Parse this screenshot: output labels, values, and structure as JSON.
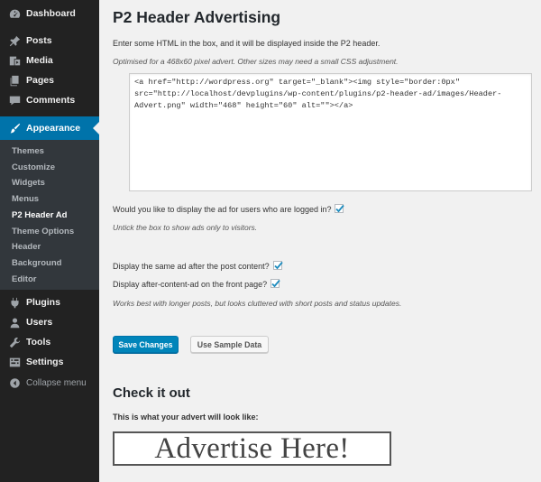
{
  "sidebar": {
    "top_items": [
      {
        "label": "Dashboard",
        "icon": "dashboard-icon"
      },
      {
        "label": "Posts",
        "icon": "pin-icon"
      },
      {
        "label": "Media",
        "icon": "media-icon"
      },
      {
        "label": "Pages",
        "icon": "pages-icon"
      },
      {
        "label": "Comments",
        "icon": "comments-icon"
      },
      {
        "label": "Appearance",
        "icon": "appearance-brush-icon",
        "active": true
      }
    ],
    "appearance_submenu": [
      {
        "label": "Themes"
      },
      {
        "label": "Customize"
      },
      {
        "label": "Widgets"
      },
      {
        "label": "Menus"
      },
      {
        "label": "P2 Header Ad",
        "current": true
      },
      {
        "label": "Theme Options"
      },
      {
        "label": "Header"
      },
      {
        "label": "Background"
      },
      {
        "label": "Editor"
      }
    ],
    "bottom_items": [
      {
        "label": "Plugins",
        "icon": "plugins-icon"
      },
      {
        "label": "Users",
        "icon": "users-icon"
      },
      {
        "label": "Tools",
        "icon": "tools-icon"
      },
      {
        "label": "Settings",
        "icon": "settings-icon"
      }
    ],
    "collapse_label": "Collapse menu",
    "active_color": "#0073aa"
  },
  "main": {
    "title": "P2 Header Advertising",
    "intro": "Enter some HTML in the box, and it will be displayed inside the P2 header.",
    "intro_note": "Optimised for a 468x60 pixel advert. Other sizes may need a small CSS adjustment.",
    "ad_html_value": "<a href=\"http://wordpress.org\" target=\"_blank\"><img style=\"border:0px\" src=\"http://localhost/devplugins/wp-content/plugins/p2-header-ad/images/Header-Advert.png\" width=\"468\" height=\"60\" alt=\"\"></a>",
    "logged_in_label": "Would you like to display the ad for users who are logged in?",
    "logged_in_checked": true,
    "logged_in_note": "Untick the box to show ads only to visitors.",
    "after_post_label": "Display the same ad after the post content?",
    "after_post_checked": true,
    "front_page_label": "Display after-content-ad on the front page?",
    "front_page_checked": true,
    "after_content_note": "Works best with longer posts, but looks cluttered with short posts and status updates.",
    "save_button": "Save Changes",
    "sample_button": "Use Sample Data",
    "preview_heading": "Check it out",
    "preview_intro": "This is what your advert will look like:",
    "preview_ad_text": "Advertise Here!",
    "primary_color": "#0085ba"
  }
}
